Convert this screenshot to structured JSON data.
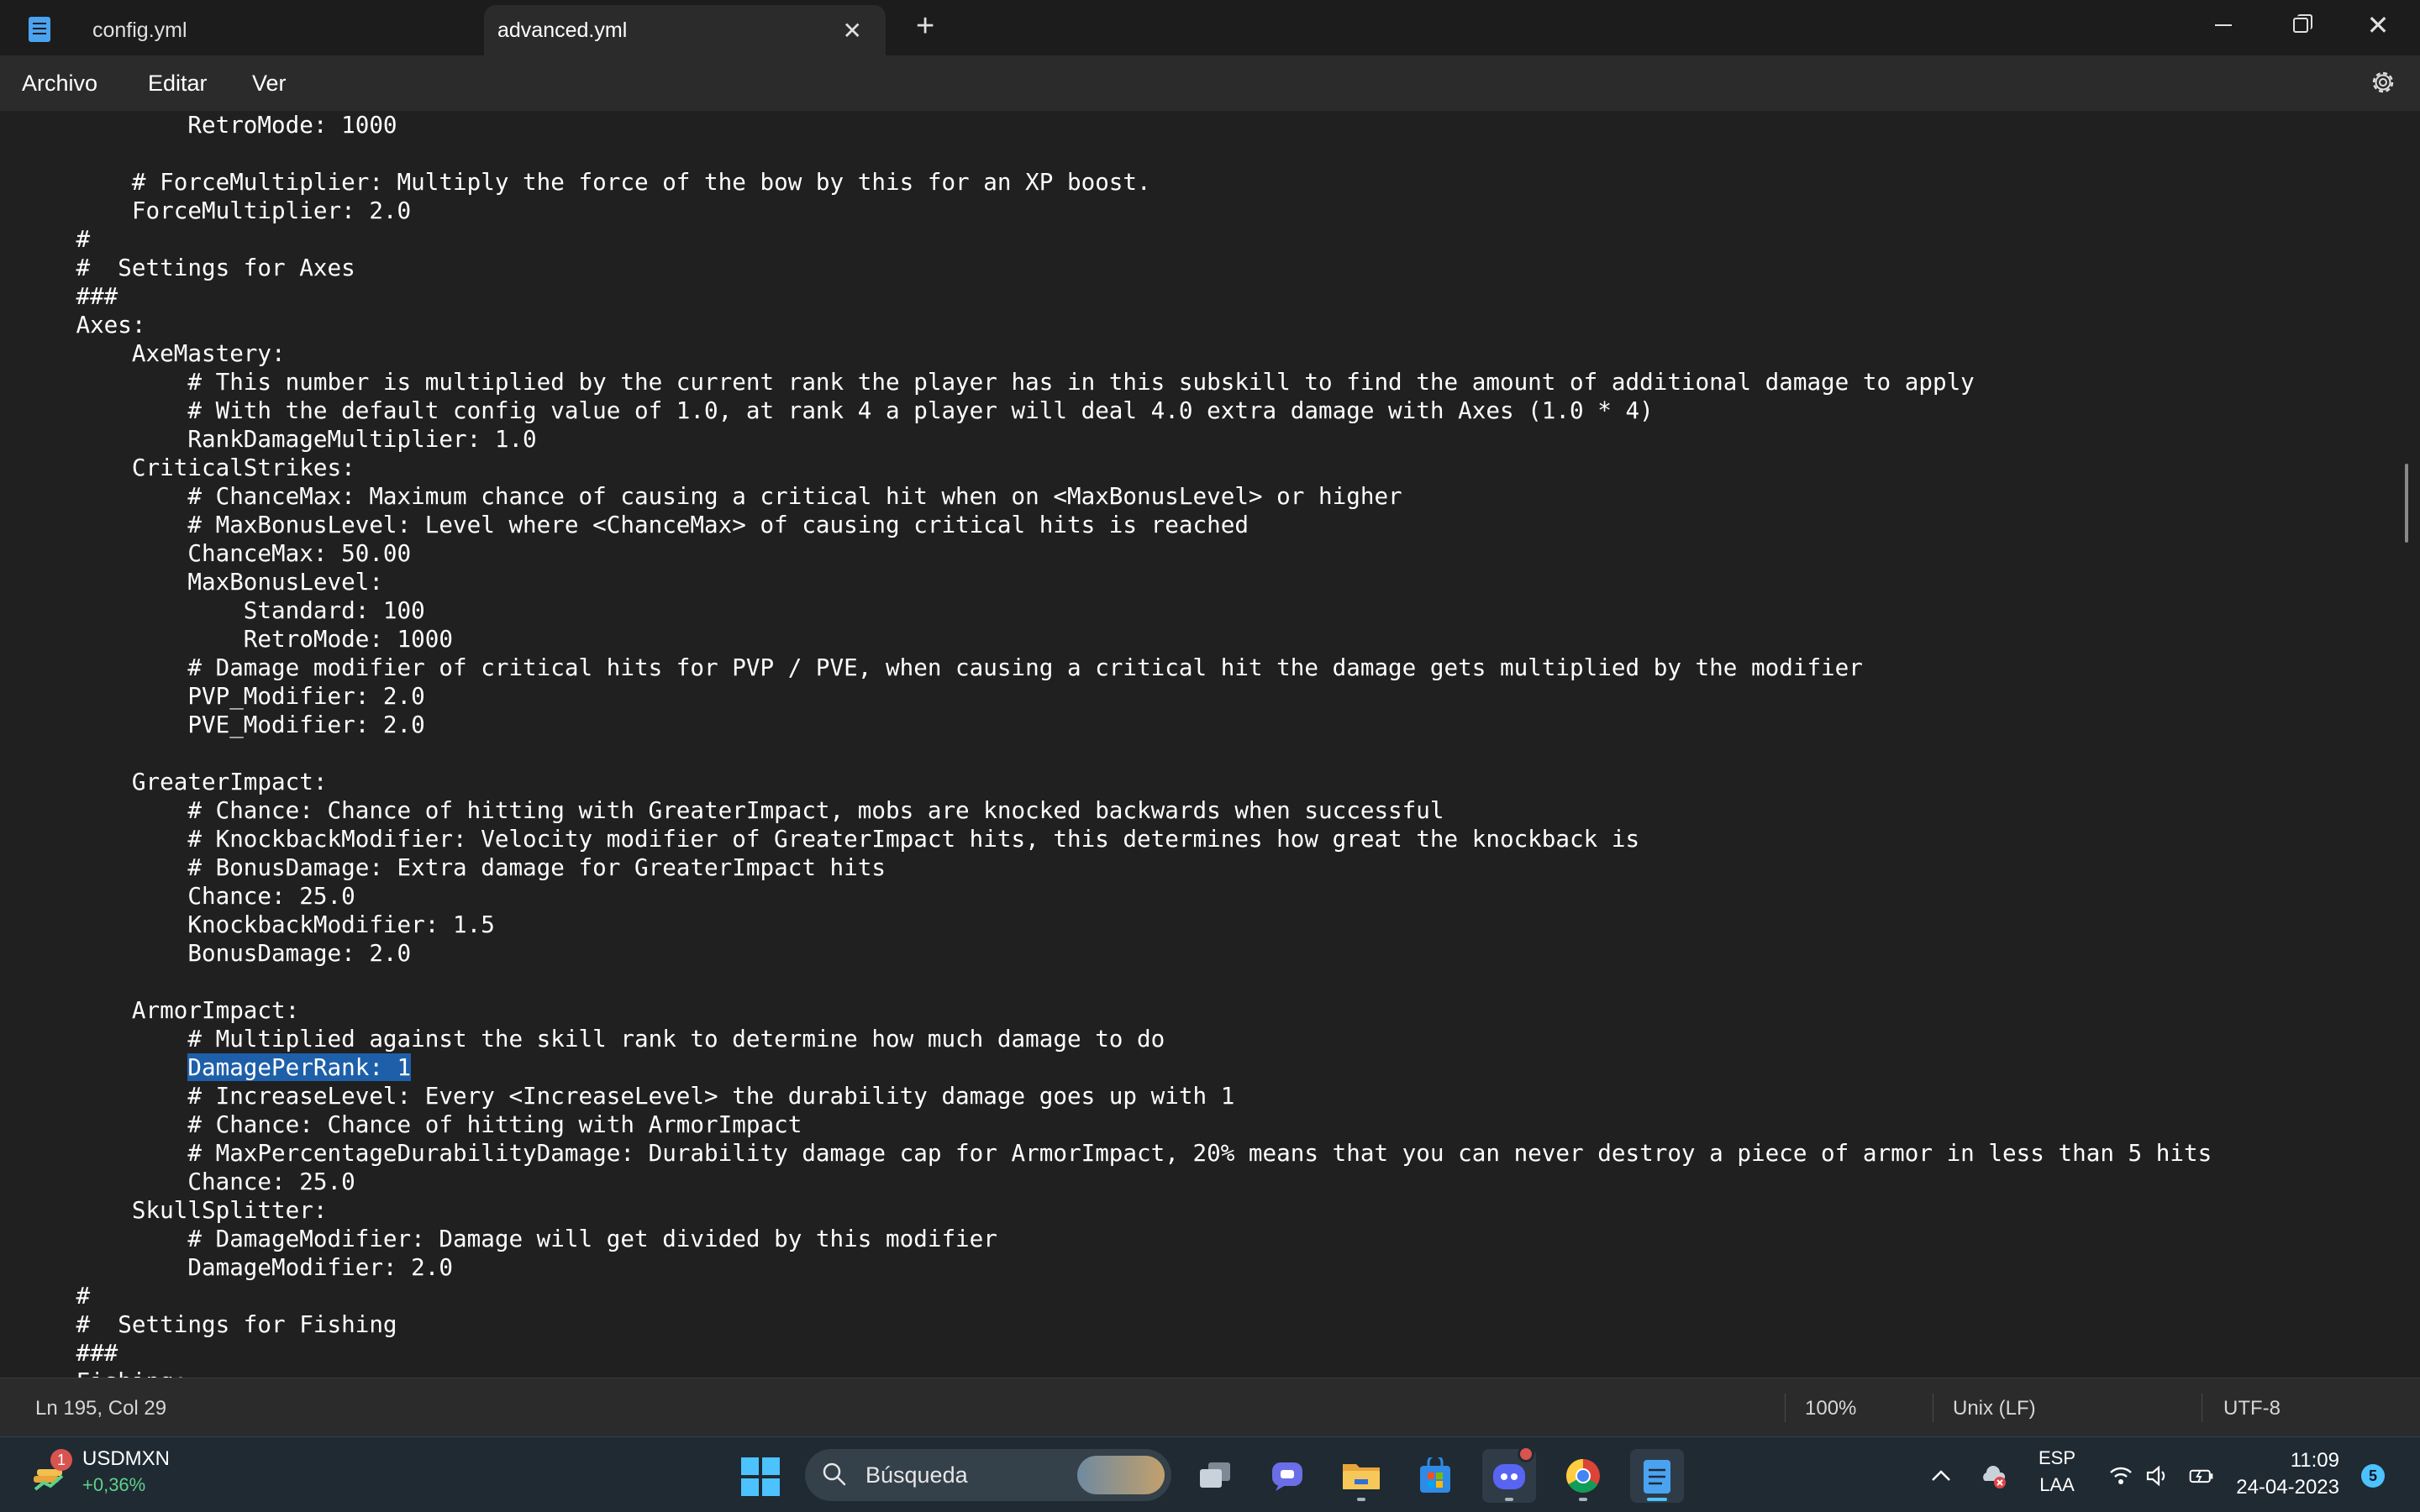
{
  "window": {
    "tabs": [
      {
        "label": "config.yml",
        "active": false
      },
      {
        "label": "advanced.yml",
        "active": true
      }
    ],
    "new_tab_label": "+",
    "close_tab_label": "✕",
    "close_window_label": "✕"
  },
  "menu": {
    "items": [
      "Archivo",
      "Editar",
      "Ver"
    ]
  },
  "editor": {
    "lines": [
      "            RetroMode: 1000",
      "",
      "        # ForceMultiplier: Multiply the force of the bow by this for an XP boost.",
      "        ForceMultiplier: 2.0",
      "    #",
      "    #  Settings for Axes",
      "    ###",
      "    Axes:",
      "        AxeMastery:",
      "            # This number is multiplied by the current rank the player has in this subskill to find the amount of additional damage to apply",
      "            # With the default config value of 1.0, at rank 4 a player will deal 4.0 extra damage with Axes (1.0 * 4)",
      "            RankDamageMultiplier: 1.0",
      "        CriticalStrikes:",
      "            # ChanceMax: Maximum chance of causing a critical hit when on <MaxBonusLevel> or higher",
      "            # MaxBonusLevel: Level where <ChanceMax> of causing critical hits is reached",
      "            ChanceMax: 50.00",
      "            MaxBonusLevel:",
      "                Standard: 100",
      "                RetroMode: 1000",
      "            # Damage modifier of critical hits for PVP / PVE, when causing a critical hit the damage gets multiplied by the modifier",
      "            PVP_Modifier: 2.0",
      "            PVE_Modifier: 2.0",
      "",
      "        GreaterImpact:",
      "            # Chance: Chance of hitting with GreaterImpact, mobs are knocked backwards when successful",
      "            # KnockbackModifier: Velocity modifier of GreaterImpact hits, this determines how great the knockback is",
      "            # BonusDamage: Extra damage for GreaterImpact hits",
      "            Chance: 25.0",
      "            KnockbackModifier: 1.5",
      "            BonusDamage: 2.0",
      "",
      "        ArmorImpact:",
      "            # Multiplied against the skill rank to determine how much damage to do",
      "            DamagePerRank: 1",
      "            # IncreaseLevel: Every <IncreaseLevel> the durability damage goes up with 1",
      "            # Chance: Chance of hitting with ArmorImpact",
      "            # MaxPercentageDurabilityDamage: Durability damage cap for ArmorImpact, 20% means that you can never destroy a piece of armor in less than 5 hits",
      "            Chance: 25.0",
      "        SkullSplitter:",
      "            # DamageModifier: Damage will get divided by this modifier",
      "            DamageModifier: 2.0",
      "    #",
      "    #  Settings for Fishing",
      "    ###",
      "    Fishing:"
    ],
    "selected_line_index": 33,
    "selected_text": "DamagePerRank: 1",
    "selected_prefix": "            "
  },
  "status": {
    "position": "Ln 195, Col 29",
    "zoom": "100%",
    "line_ending": "Unix (LF)",
    "encoding": "UTF-8"
  },
  "taskbar": {
    "widget": {
      "ticker": "USDMXN",
      "change": "+0,36%",
      "badge": "1"
    },
    "search_label": "Búsqueda",
    "lang_top": "ESP",
    "lang_bottom": "LAA",
    "time": "11:09",
    "date": "24-04-2023",
    "notifications": "5"
  },
  "colors": {
    "accent": "#4cc2ff",
    "selection": "#1e5faa",
    "editor_bg": "#202020",
    "chrome_bg": "#2b2b2b"
  }
}
